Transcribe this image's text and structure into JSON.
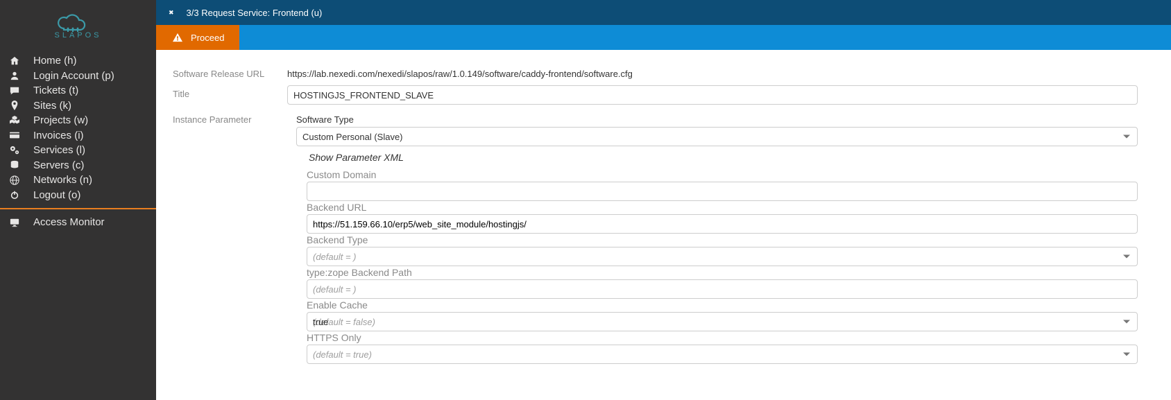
{
  "logo": {
    "brand": "SLAPOS"
  },
  "sidebar": {
    "items": [
      {
        "label": "Home (h)",
        "icon": "home"
      },
      {
        "label": "Login Account (p)",
        "icon": "user"
      },
      {
        "label": "Tickets (t)",
        "icon": "comment"
      },
      {
        "label": "Sites (k)",
        "icon": "map-marker"
      },
      {
        "label": "Projects (w)",
        "icon": "cubes"
      },
      {
        "label": "Invoices (i)",
        "icon": "credit-card"
      },
      {
        "label": "Services (l)",
        "icon": "cogs"
      },
      {
        "label": "Servers (c)",
        "icon": "database"
      },
      {
        "label": "Networks (n)",
        "icon": "globe"
      },
      {
        "label": "Logout (o)",
        "icon": "power-off"
      }
    ],
    "monitor": {
      "label": "Access Monitor",
      "icon": "desktop"
    }
  },
  "header": {
    "title": "3/3 Request Service: Frontend (u)",
    "proceed": "Proceed"
  },
  "form": {
    "soft_url_label": "Software Release URL",
    "soft_url": "https://lab.nexedi.com/nexedi/slapos/raw/1.0.149/software/caddy-frontend/software.cfg",
    "title_label": "Title",
    "title": "HOSTINGJS_FRONTEND_SLAVE",
    "inst_param_label": "Instance Parameter",
    "soft_type_label": "Software Type",
    "soft_type": "Custom Personal (Slave)",
    "show_xml": "Show Parameter XML",
    "params": {
      "custom_domain": {
        "label": "Custom Domain",
        "value": ""
      },
      "backend_url": {
        "label": "Backend URL",
        "value": "https://51.159.66.10/erp5/web_site_module/hostingjs/"
      },
      "backend_type": {
        "label": "Backend Type",
        "placeholder": "(default = )"
      },
      "zope_path": {
        "label": "type:zope Backend Path",
        "placeholder": "(default = )"
      },
      "enable_cache": {
        "label": "Enable Cache",
        "placeholder": "(default = false)",
        "value": "true"
      },
      "https_only": {
        "label": "HTTPS Only",
        "placeholder": "(default = true)"
      }
    }
  }
}
